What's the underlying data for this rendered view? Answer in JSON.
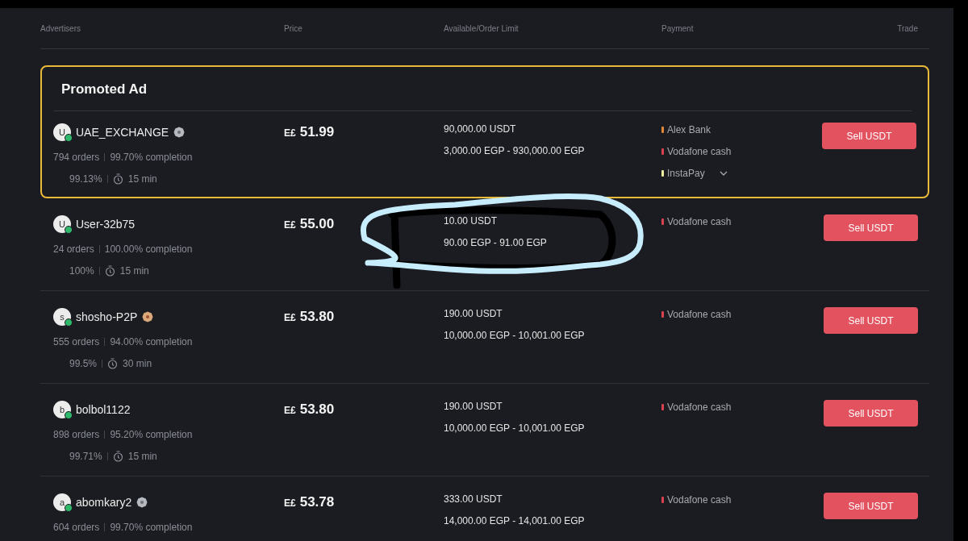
{
  "columns": [
    "Advertisers",
    "Price",
    "Available/Order Limit",
    "Payment",
    "Trade"
  ],
  "promoted": {
    "title": "Promoted Ad",
    "ads": [
      {
        "avatar": "U",
        "online": true,
        "name": "UAE_EXCHANGE",
        "badge": {
          "kind": "silver"
        },
        "orders": "794 orders",
        "completion": "99.70% completion",
        "rate": "99.13%",
        "time": "15 min",
        "currency": "E£",
        "price": "51.99",
        "available": "90,000.00 USDT",
        "limit": "3,000.00 EGP - 930,000.00 EGP",
        "payments": [
          {
            "name": "Alex Bank",
            "color": "#e0873a"
          },
          {
            "name": "Vodafone cash",
            "color": "#d8434f"
          },
          {
            "name": "InstaPay",
            "color": "#eef0a0"
          }
        ],
        "expanded": false,
        "action": "Sell USDT"
      }
    ]
  },
  "ads": [
    {
      "avatar": "U",
      "online": true,
      "name": "User-32b75",
      "orders": "24 orders",
      "completion": "100.00% completion",
      "rate": "100%",
      "time": "15 min",
      "currency": "E£",
      "price": "55.00",
      "available": "10.00 USDT",
      "limit": "90.00 EGP - 91.00 EGP",
      "payments": [
        {
          "name": "Vodafone cash",
          "color": "#d8434f"
        }
      ],
      "action": "Sell USDT"
    },
    {
      "avatar": "s",
      "online": true,
      "name": "shosho-P2P",
      "badge": {
        "kind": "gold"
      },
      "orders": "555 orders",
      "completion": "94.00% completion",
      "rate": "99.5%",
      "time": "30 min",
      "currency": "E£",
      "price": "53.80",
      "available": "190.00 USDT",
      "limit": "10,000.00 EGP - 10,001.00 EGP",
      "payments": [
        {
          "name": "Vodafone cash",
          "color": "#d8434f"
        }
      ],
      "action": "Sell USDT"
    },
    {
      "avatar": "b",
      "online": true,
      "name": "bolbol1122",
      "orders": "898 orders",
      "completion": "95.20% completion",
      "rate": "99.71%",
      "time": "15 min",
      "currency": "E£",
      "price": "53.80",
      "available": "190.00 USDT",
      "limit": "10,000.00 EGP - 10,001.00 EGP",
      "payments": [
        {
          "name": "Vodafone cash",
          "color": "#d8434f"
        }
      ],
      "action": "Sell USDT"
    },
    {
      "avatar": "a",
      "online": true,
      "name": "abomkary2",
      "badge": {
        "kind": "silver"
      },
      "orders": "604 orders",
      "completion": "99.70% completion",
      "currency": "E£",
      "price": "53.78",
      "available": "333.00 USDT",
      "limit": "14,000.00 EGP - 14,001.00 EGP",
      "payments": [
        {
          "name": "Vodafone cash",
          "color": "#d8434f"
        }
      ],
      "action": "Sell USDT"
    }
  ]
}
